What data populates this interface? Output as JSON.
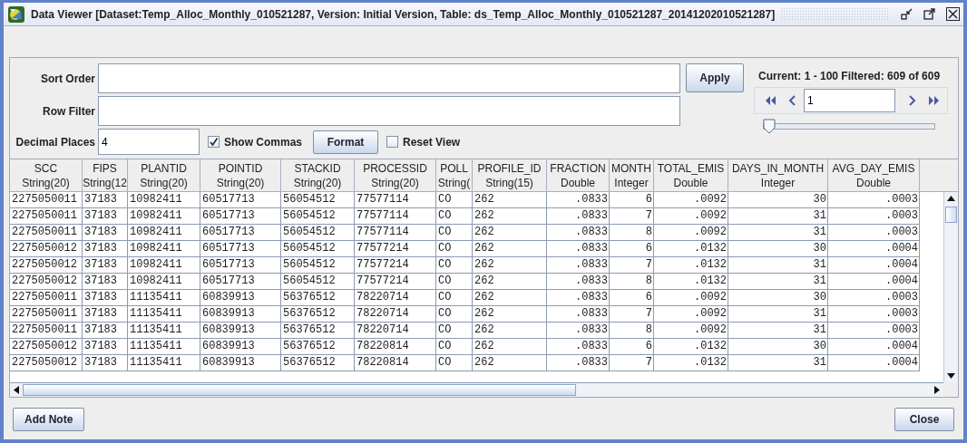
{
  "window": {
    "title": "Data Viewer [Dataset:Temp_Alloc_Monthly_010521287, Version: Initial Version, Table: ds_Temp_Alloc_Monthly_010521287_20141202010521287]"
  },
  "sort_order": {
    "label": "Sort Order"
  },
  "row_filter": {
    "label": "Row Filter"
  },
  "apply_button": "Apply",
  "decimal_places": {
    "label": "Decimal Places",
    "value": "4"
  },
  "show_commas": {
    "label": "Show Commas",
    "checked": true
  },
  "format_button": "Format",
  "reset_view": {
    "label": "Reset View",
    "checked": false
  },
  "paging": {
    "status": "Current: 1 - 100 Filtered: 609 of 609",
    "page": "1",
    "slider": {
      "level": 0
    }
  },
  "table": {
    "columns": [
      {
        "name": "SCC",
        "type": "String(20)",
        "kind": "text"
      },
      {
        "name": "FIPS",
        "type": "String(12",
        "kind": "text"
      },
      {
        "name": "PLANTID",
        "type": "String(20)",
        "kind": "text"
      },
      {
        "name": "POINTID",
        "type": "String(20)",
        "kind": "text"
      },
      {
        "name": "STACKID",
        "type": "String(20)",
        "kind": "text"
      },
      {
        "name": "PROCESSID",
        "type": "String(20)",
        "kind": "text"
      },
      {
        "name": "POLL",
        "type": "String(",
        "kind": "text"
      },
      {
        "name": "PROFILE_ID",
        "type": "String(15)",
        "kind": "text"
      },
      {
        "name": "FRACTION",
        "type": "Double",
        "kind": "number"
      },
      {
        "name": "MONTH",
        "type": "Integer",
        "kind": "number"
      },
      {
        "name": "TOTAL_EMIS",
        "type": "Double",
        "kind": "number"
      },
      {
        "name": "DAYS_IN_MONTH",
        "type": "Integer",
        "kind": "number"
      },
      {
        "name": "AVG_DAY_EMIS",
        "type": "Double",
        "kind": "number"
      }
    ],
    "rows": [
      [
        "2275050011",
        "37183",
        "10982411",
        "60517713",
        "56054512",
        "77577114",
        "CO",
        "262",
        ".0833",
        "6",
        ".0092",
        "30",
        ".0003"
      ],
      [
        "2275050011",
        "37183",
        "10982411",
        "60517713",
        "56054512",
        "77577114",
        "CO",
        "262",
        ".0833",
        "7",
        ".0092",
        "31",
        ".0003"
      ],
      [
        "2275050011",
        "37183",
        "10982411",
        "60517713",
        "56054512",
        "77577114",
        "CO",
        "262",
        ".0833",
        "8",
        ".0092",
        "31",
        ".0003"
      ],
      [
        "2275050012",
        "37183",
        "10982411",
        "60517713",
        "56054512",
        "77577214",
        "CO",
        "262",
        ".0833",
        "6",
        ".0132",
        "30",
        ".0004"
      ],
      [
        "2275050012",
        "37183",
        "10982411",
        "60517713",
        "56054512",
        "77577214",
        "CO",
        "262",
        ".0833",
        "7",
        ".0132",
        "31",
        ".0004"
      ],
      [
        "2275050012",
        "37183",
        "10982411",
        "60517713",
        "56054512",
        "77577214",
        "CO",
        "262",
        ".0833",
        "8",
        ".0132",
        "31",
        ".0004"
      ],
      [
        "2275050011",
        "37183",
        "11135411",
        "60839913",
        "56376512",
        "78220714",
        "CO",
        "262",
        ".0833",
        "6",
        ".0092",
        "30",
        ".0003"
      ],
      [
        "2275050011",
        "37183",
        "11135411",
        "60839913",
        "56376512",
        "78220714",
        "CO",
        "262",
        ".0833",
        "7",
        ".0092",
        "31",
        ".0003"
      ],
      [
        "2275050011",
        "37183",
        "11135411",
        "60839913",
        "56376512",
        "78220714",
        "CO",
        "262",
        ".0833",
        "8",
        ".0092",
        "31",
        ".0003"
      ],
      [
        "2275050012",
        "37183",
        "11135411",
        "60839913",
        "56376512",
        "78220814",
        "CO",
        "262",
        ".0833",
        "6",
        ".0132",
        "30",
        ".0004"
      ],
      [
        "2275050012",
        "37183",
        "11135411",
        "60839913",
        "56376512",
        "78220814",
        "CO",
        "262",
        ".0833",
        "7",
        ".0132",
        "31",
        ".0004"
      ]
    ]
  },
  "buttons": [
    {
      "label": "Add Note"
    },
    {
      "label": "Close"
    }
  ]
}
